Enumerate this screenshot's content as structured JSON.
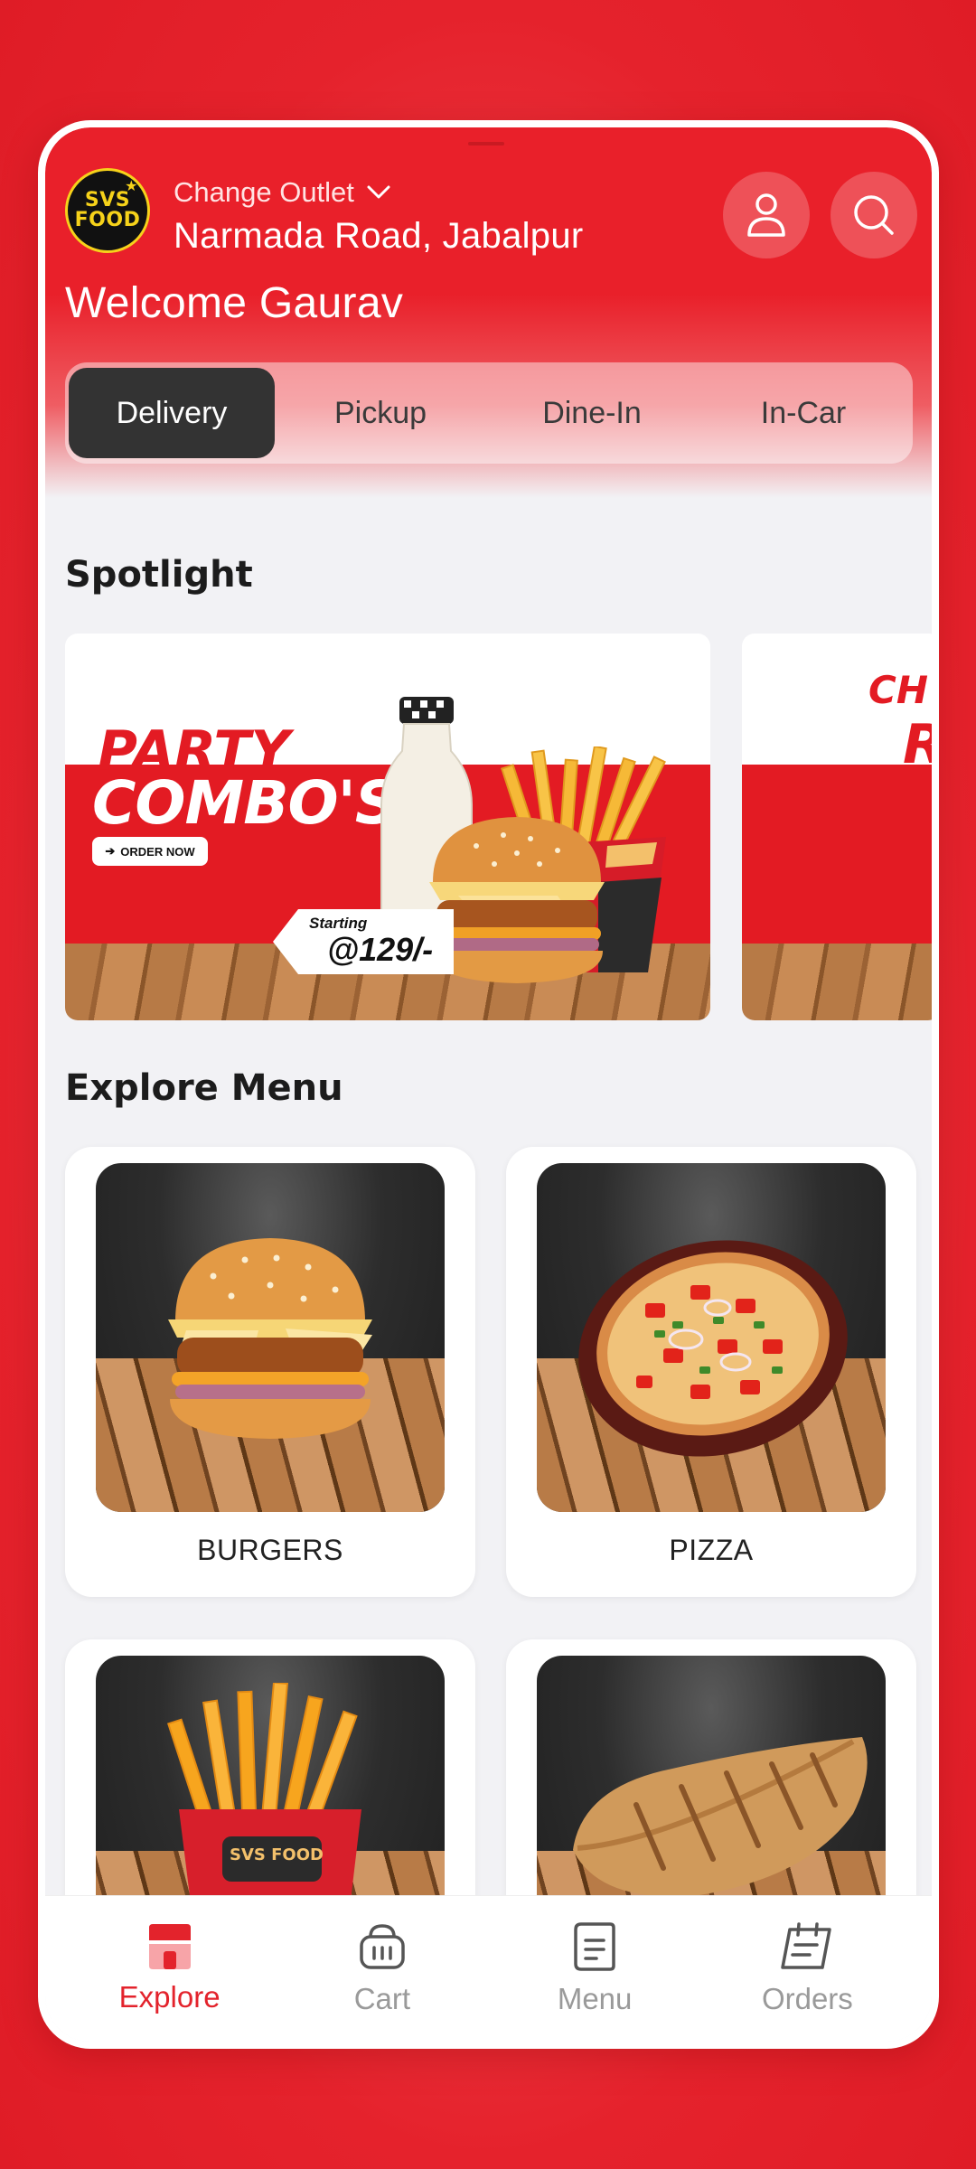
{
  "header": {
    "logo_text_top": "SVS",
    "logo_text_bottom": "FOOD",
    "change_outlet_label": "Change Outlet",
    "outlet_name": "Narmada Road, Jabalpur",
    "welcome_text": "Welcome Gaurav"
  },
  "order_tabs": [
    {
      "label": "Delivery",
      "active": true
    },
    {
      "label": "Pickup",
      "active": false
    },
    {
      "label": "Dine-In",
      "active": false
    },
    {
      "label": "In-Car",
      "active": false
    }
  ],
  "spotlight": {
    "title": "Spotlight",
    "banners": [
      {
        "headline_top": "PARTY",
        "headline_main": "COMBO'S",
        "cta": "ORDER NOW",
        "price_prefix": "Starting",
        "price": "@129/-"
      },
      {
        "headline_top": "CH",
        "headline_main": "R"
      }
    ]
  },
  "explore_menu": {
    "title": "Explore Menu",
    "items": [
      {
        "label": "BURGERS"
      },
      {
        "label": "PIZZA"
      },
      {
        "label": ""
      },
      {
        "label": ""
      }
    ],
    "fries_pack_text": "SVS FOOD"
  },
  "bottom_nav": [
    {
      "label": "Explore",
      "icon": "store-icon",
      "active": true
    },
    {
      "label": "Cart",
      "icon": "basket-icon",
      "active": false
    },
    {
      "label": "Menu",
      "icon": "menu-book-icon",
      "active": false
    },
    {
      "label": "Orders",
      "icon": "orders-calendar-icon",
      "active": false
    }
  ],
  "colors": {
    "brand_red": "#e9202a",
    "active_tab_bg": "#333333",
    "nav_active": "#e3232c",
    "nav_inactive": "#9a9a9a"
  }
}
